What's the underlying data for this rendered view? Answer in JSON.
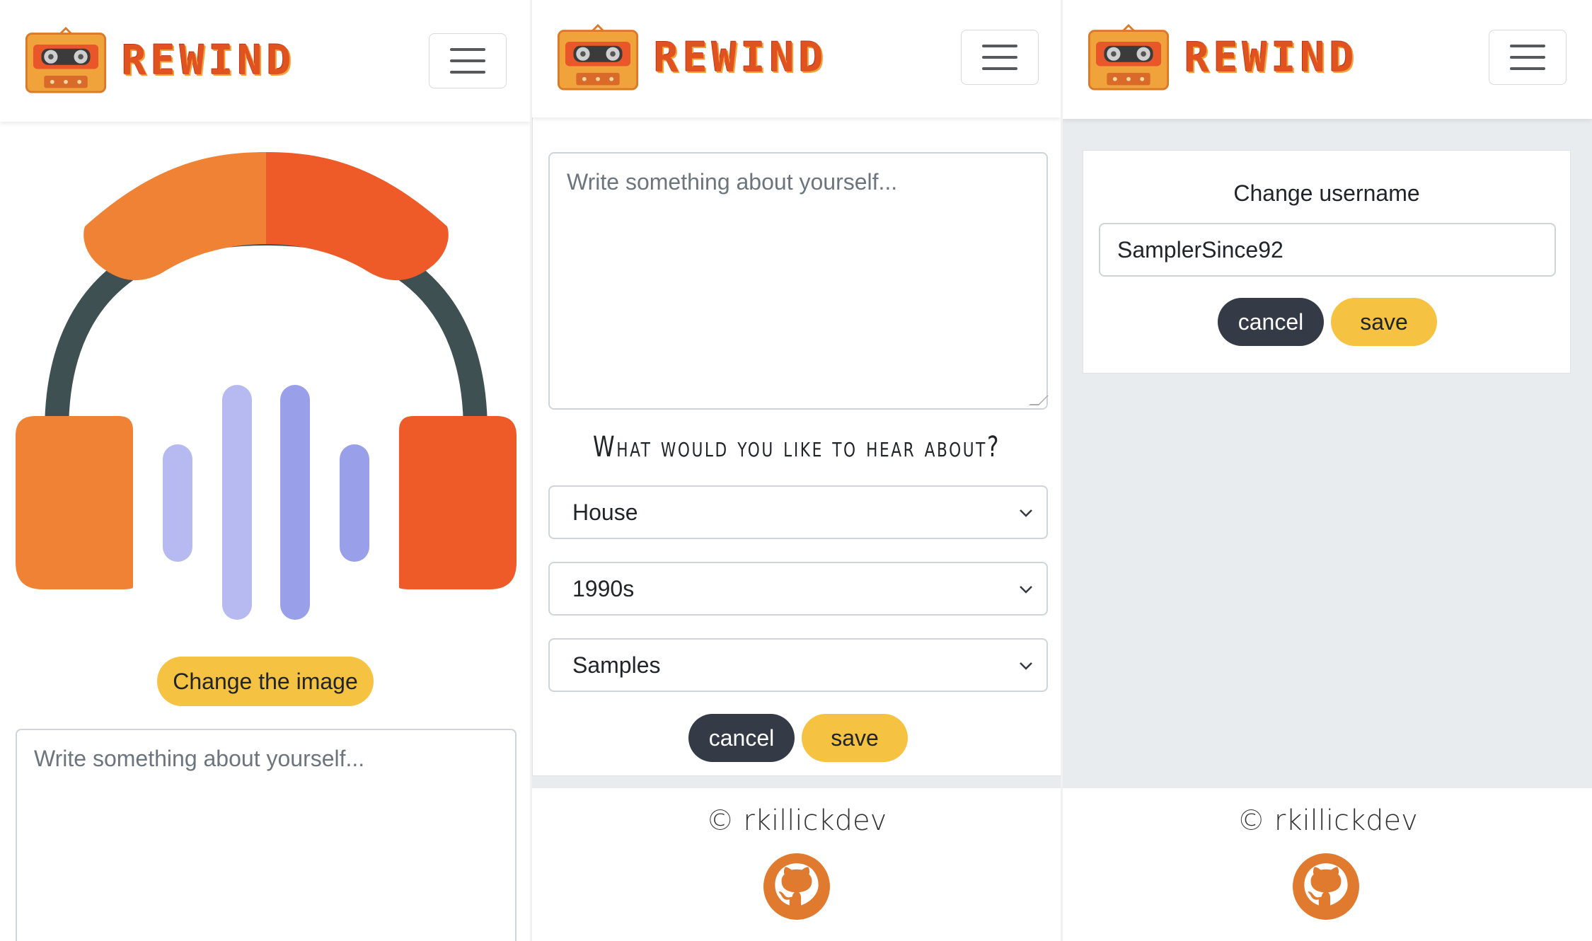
{
  "brand": {
    "name": "REWIND",
    "logo_icon": "cassette-tape-icon"
  },
  "navbar": {
    "menu_icon": "hamburger-menu-icon"
  },
  "colors": {
    "accent_yellow": "#f5c242",
    "dark_button": "#343a46",
    "brand_orange": "#e0521f",
    "page_background": "#e9ecef"
  },
  "panel1": {
    "profile_image_icon": "headphones-soundwave-icon",
    "change_image_label": "Change the image",
    "bio_placeholder": "Write something about yourself..."
  },
  "panel2": {
    "bio_placeholder": "Write something about yourself...",
    "preferences_heading": "What would you like to hear about?",
    "selects": [
      {
        "name": "genre",
        "value": "House"
      },
      {
        "name": "decade",
        "value": "1990s"
      },
      {
        "name": "category",
        "value": "Samples"
      }
    ],
    "cancel_label": "cancel",
    "save_label": "save"
  },
  "panel3": {
    "heading": "Change username",
    "username_value": "SamplerSince92",
    "cancel_label": "cancel",
    "save_label": "save"
  },
  "footer": {
    "copyright": "© rkillickdev",
    "github_icon": "github-icon"
  }
}
